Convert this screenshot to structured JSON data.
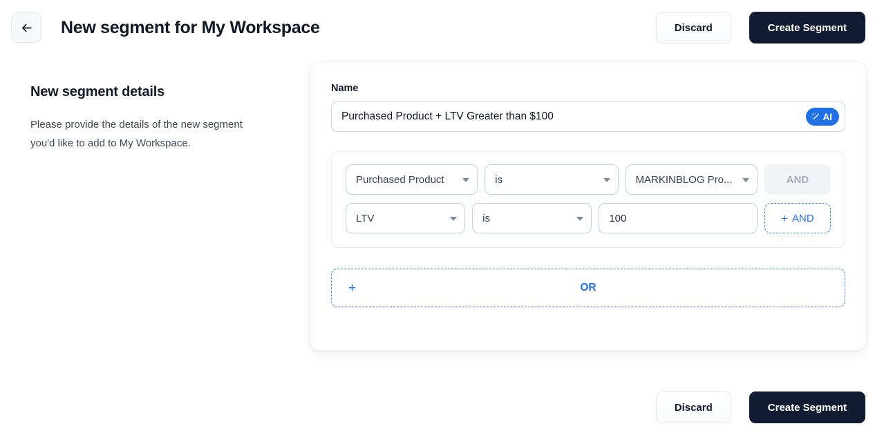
{
  "header": {
    "back_icon": "arrow-left-icon",
    "title": "New segment for My Workspace",
    "discard_label": "Discard",
    "create_label": "Create Segment"
  },
  "left_panel": {
    "title": "New segment details",
    "description": "Please provide the details of the new segment you'd like to add to My Workspace."
  },
  "form": {
    "name_label": "Name",
    "name_value": "Purchased Product + LTV Greater than $100",
    "name_placeholder": "Segment name",
    "ai_badge": {
      "label": "AI",
      "icon": "magic-wand-sparkle-icon",
      "color": "#1f6fe5"
    }
  },
  "filter_group": {
    "rows": [
      {
        "attribute": "Purchased Product",
        "operator": "is",
        "value": "MARKINBLOG Pro...",
        "value_type": "select",
        "connector_label": "AND",
        "connector_state": "disabled"
      },
      {
        "attribute": "LTV",
        "operator": "is",
        "value": "100",
        "value_type": "input",
        "connector_label": "AND",
        "connector_state": "add",
        "connector_plus": "+"
      }
    ]
  },
  "or_button": {
    "plus": "+",
    "label": "OR"
  },
  "footer": {
    "discard_label": "Discard",
    "create_label": "Create Segment"
  },
  "colors": {
    "accent_blue": "#1f6fe5",
    "primary_dark": "#111c33",
    "dashed_blue": "#3b82f6",
    "border_gray": "#c3d0dd"
  }
}
